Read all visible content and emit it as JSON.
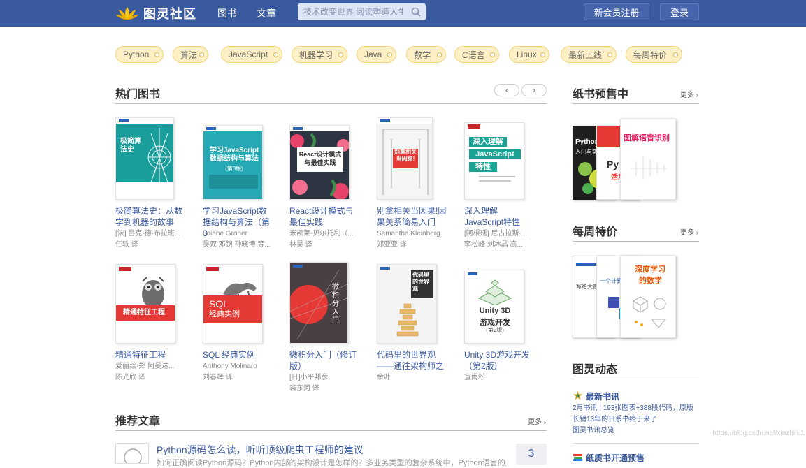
{
  "header": {
    "logo_text": "图灵社区",
    "nav": [
      "图书",
      "文章"
    ],
    "search_placeholder": "技术改变世界 阅读塑造人生",
    "register": "新会员注册",
    "login": "登录"
  },
  "tags": [
    "Python",
    "算法",
    "JavaScript",
    "机器学习",
    "Java",
    "数学",
    "C语言",
    "Linux",
    "最新上线",
    "每周特价"
  ],
  "hot_books": {
    "title": "热门图书",
    "prev": "‹",
    "next": "›",
    "books": [
      {
        "title": "极简算法史：从数学到机器的故事",
        "author1": "[法] 吕克·德·布拉班...",
        "author2": "任轶  译"
      },
      {
        "title": "学习JavaScript数据结构与算法（第3",
        "author1": "Loiane Groner",
        "author2": "吴双 邓钢 孙晓博 等..."
      },
      {
        "title": "React设计模式与最佳实践",
        "author1": "米凯莱·贝尔托利（...",
        "author2": "林昊  译"
      },
      {
        "title": "别拿相关当因果!因果关系简易入门",
        "author1": "Samantha Kleinberg",
        "author2": "郑亚亚  译"
      },
      {
        "title": "深入理解JavaScript特性",
        "author1": "[阿根廷] 尼古拉斯·...",
        "author2": "李松峰  刘冰晶  高..."
      },
      {
        "title": "精通特征工程",
        "author1": "爱丽丝·郑  阿曼达...",
        "author2": "陈光欣  译"
      },
      {
        "title": "SQL 经典实例",
        "author1": "Anthony Molinaro",
        "author2": "刘春辉  译"
      },
      {
        "title": "微积分入门（修订版）",
        "author1": "[日]小平邦彦",
        "author2": "裴东河  译"
      },
      {
        "title": "代码里的世界观——通往架构师之",
        "author1": "余叶",
        "author2": ""
      },
      {
        "title": "Unity 3D游戏开发（第2版）",
        "author1": "宣雨松",
        "author2": ""
      }
    ],
    "covers": [
      {
        "title": "极简算法史",
        "bg": "#1a9e9c"
      },
      {
        "title": "学习JavaScript数据结构与算法",
        "sub": "(第3版)",
        "bg": "#27a9b5"
      },
      {
        "title": "React设计模式与最佳实践",
        "bg": "#2d3542"
      },
      {
        "title": "别拿相关当因果!",
        "bg": "#f5f5f5"
      },
      {
        "title": "深入理解",
        "title2": "JavaScript",
        "title3": "特性",
        "bg": "#ffffff"
      },
      {
        "title": "精通特征工程",
        "bg": "#ffffff"
      },
      {
        "title": "SQL",
        "title2": "经典实例",
        "bg": "#ffffff"
      },
      {
        "title": "微积分入门",
        "bg": "#4a3f42"
      },
      {
        "title": "代码里的世界观",
        "bg": "#f4f4f4"
      },
      {
        "title": "Unity 3D",
        "title2": "游戏开发",
        "sub": "(第2版)",
        "bg": "#ffffff"
      }
    ]
  },
  "articles": {
    "title": "推荐文章",
    "more": "更多 ›",
    "first_title": "Python源码怎么读，听听顶级爬虫工程师的建议",
    "first_excerpt": "如何正确阅读Python源码？Python内部的架构设计是怎样的？多业务类型的复杂系统中，Python语言的边界是",
    "count": "3"
  },
  "presale": {
    "title": "纸书预售中",
    "more": "更多 ›",
    "cover_texts": [
      "Python",
      "入门与实践",
      "Py",
      "活用",
      "图解语音识别"
    ]
  },
  "weekly": {
    "title": "每周特价",
    "more": "更多 ›",
    "cover_texts": [
      "写给大家的",
      "一个计算",
      "深度学习",
      "的数学"
    ]
  },
  "news": {
    "title": "图灵动态",
    "item1_title": "最新书讯",
    "item1_lines": [
      "2月书讯 | 193张图表+388段代码，原版",
      "长销13年的日系书终于来了",
      "图灵书讯总览"
    ],
    "item2_title": "纸质书开通预售"
  },
  "watermark": "https://blog.csdn.net/xinzhifu1"
}
